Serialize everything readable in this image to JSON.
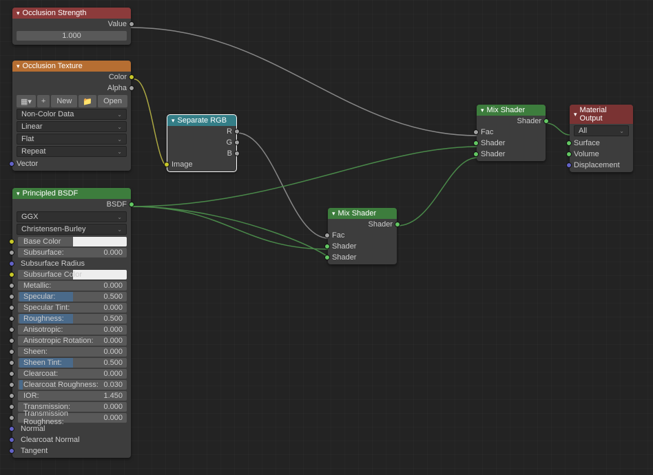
{
  "nodes": {
    "occlusion_strength": {
      "title": "Occlusion Strength",
      "value_label": "Value",
      "value": "1.000"
    },
    "occlusion_texture": {
      "title": "Occlusion Texture",
      "color_label": "Color",
      "alpha_label": "Alpha",
      "new_btn": "New",
      "open_btn": "Open",
      "dropdowns": [
        "Non-Color Data",
        "Linear",
        "Flat",
        "Repeat"
      ],
      "vector_label": "Vector"
    },
    "separate_rgb": {
      "title": "Separate RGB",
      "outputs": [
        "R",
        "G",
        "B"
      ],
      "image_label": "Image"
    },
    "mix_shader1": {
      "title": "Mix Shader",
      "shader_out": "Shader",
      "inputs": [
        "Fac",
        "Shader",
        "Shader"
      ]
    },
    "mix_shader2": {
      "title": "Mix Shader",
      "shader_out": "Shader",
      "inputs": [
        "Fac",
        "Shader",
        "Shader"
      ]
    },
    "material_output": {
      "title": "Material Output",
      "dropdown": "All",
      "inputs": [
        "Surface",
        "Volume",
        "Displacement"
      ]
    },
    "principled": {
      "title": "Principled BSDF",
      "bsdf_label": "BSDF",
      "dropdowns": [
        "GGX",
        "Christensen-Burley"
      ],
      "props": [
        {
          "name": "Base Color",
          "type": "color",
          "socket": "col"
        },
        {
          "name": "Subsurface:",
          "val": "0.000",
          "fill": "0%",
          "socket": "val"
        },
        {
          "name": "Subsurface Radius",
          "type": "label",
          "socket": "vec"
        },
        {
          "name": "Subsurface Color",
          "type": "color",
          "socket": "col"
        },
        {
          "name": "Metallic:",
          "val": "0.000",
          "fill": "0%",
          "socket": "val"
        },
        {
          "name": "Specular:",
          "val": "0.500",
          "fill": "50%",
          "socket": "val"
        },
        {
          "name": "Specular Tint:",
          "val": "0.000",
          "fill": "0%",
          "socket": "val"
        },
        {
          "name": "Roughness:",
          "val": "0.500",
          "fill": "50%",
          "socket": "val"
        },
        {
          "name": "Anisotropic:",
          "val": "0.000",
          "fill": "0%",
          "socket": "val"
        },
        {
          "name": "Anisotropic Rotation:",
          "val": "0.000",
          "fill": "0%",
          "socket": "val"
        },
        {
          "name": "Sheen:",
          "val": "0.000",
          "fill": "0%",
          "socket": "val"
        },
        {
          "name": "Sheen Tint:",
          "val": "0.500",
          "fill": "50%",
          "socket": "val"
        },
        {
          "name": "Clearcoat:",
          "val": "0.000",
          "fill": "0%",
          "socket": "val"
        },
        {
          "name": "Clearcoat Roughness:",
          "val": "0.030",
          "fill": "3%",
          "socket": "val"
        },
        {
          "name": "IOR:",
          "val": "1.450",
          "fill": "0%",
          "socket": "val"
        },
        {
          "name": "Transmission:",
          "val": "0.000",
          "fill": "0%",
          "socket": "val"
        },
        {
          "name": "Transmission Roughness:",
          "val": "0.000",
          "fill": "0%",
          "socket": "val"
        },
        {
          "name": "Normal",
          "type": "label",
          "socket": "vec"
        },
        {
          "name": "Clearcoat Normal",
          "type": "label",
          "socket": "vec"
        },
        {
          "name": "Tangent",
          "type": "label",
          "socket": "vec"
        }
      ]
    }
  }
}
